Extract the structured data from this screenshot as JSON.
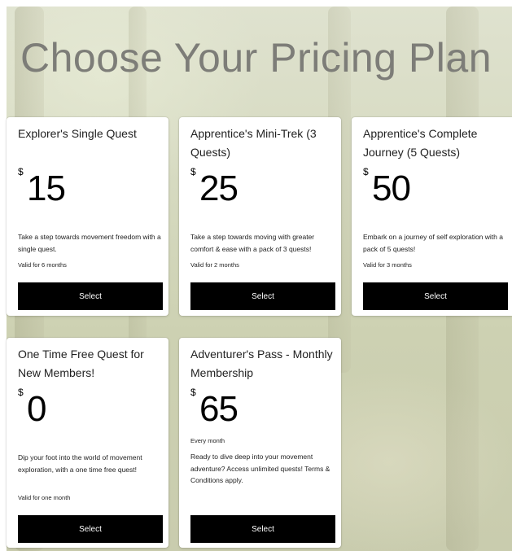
{
  "page": {
    "title": "Choose Your Pricing Plan"
  },
  "plans": [
    {
      "name": "Explorer's Single Quest",
      "currency": "$",
      "price": "15",
      "description": "Take a step towards movement freedom with a single quest.",
      "validity": "Valid for 6 months",
      "button_label": "Select"
    },
    {
      "name": "Apprentice's Mini-Trek (3 Quests)",
      "currency": "$",
      "price": "25",
      "description": "Take a step towards moving with greater comfort & ease with a pack of 3 quests!",
      "validity": "Valid for 2 months",
      "button_label": "Select"
    },
    {
      "name": "Apprentice's Complete Journey (5 Quests)",
      "currency": "$",
      "price": "50",
      "description": "Embark on a journey of self exploration with a pack of 5 quests!",
      "validity": "Valid for 3 months",
      "button_label": "Select"
    },
    {
      "name": "One Time Free Quest for New Members!",
      "currency": "$",
      "price": "0",
      "description": "Dip your foot into the world of movement exploration, with a one time free quest!",
      "validity": "Valid for one month",
      "button_label": "Select"
    },
    {
      "name": "Adventurer's Pass - Monthly Membership",
      "currency": "$",
      "price": "65",
      "billing_cycle": "Every month",
      "description": "Ready to dive deep into your movement adventure? Access unlimited quests! Terms & Conditions apply.",
      "button_label": "Select"
    }
  ]
}
